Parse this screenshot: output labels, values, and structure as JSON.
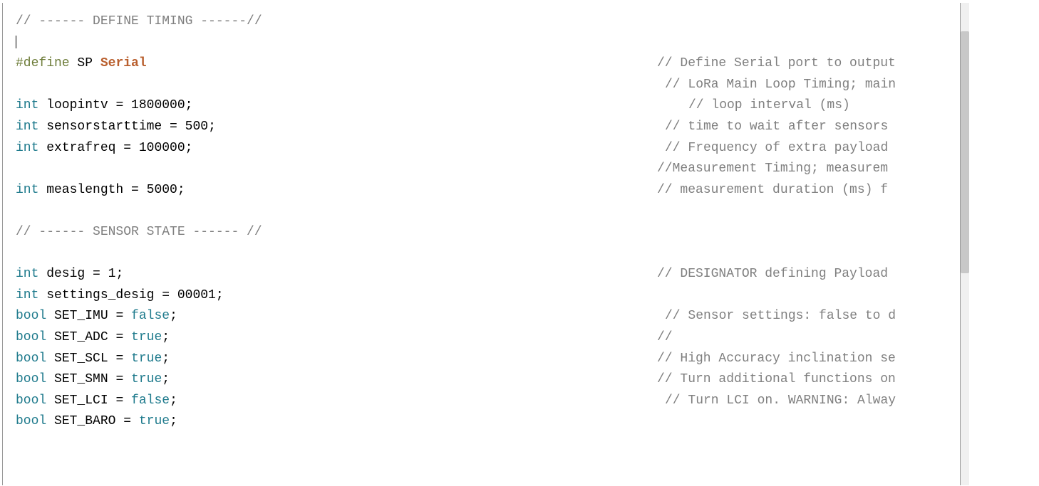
{
  "code": {
    "l1": {
      "text": "// ------ DEFINE TIMING ------//"
    },
    "l2": {
      "cursor": true
    },
    "l3": {
      "pre": "#define",
      "macro": " SP ",
      "ident": "Serial",
      "rcol": 918,
      "rcomment": "// Define Serial port to output"
    },
    "l4": {
      "rcol": 929,
      "rcomment": "// LoRa Main Loop Timing; main"
    },
    "l5": {
      "type": "int",
      "name": " loopintv ",
      "eq": "= ",
      "val": "1800000",
      "semi": ";",
      "rcol": 962,
      "rcomment": "// loop interval (ms)"
    },
    "l6": {
      "type": "int",
      "name": " sensorstarttime ",
      "eq": "= ",
      "val": "500",
      "semi": ";",
      "rcol": 929,
      "rcomment": "// time to wait after sensors "
    },
    "l7": {
      "type": "int",
      "name": " extrafreq ",
      "eq": "= ",
      "val": "100000",
      "semi": ";",
      "rcol": 929,
      "rcomment": "// Frequency of extra payload "
    },
    "l8": {
      "rcol": 918,
      "rcomment": "//Measurement Timing; measurem"
    },
    "l9": {
      "type": "int",
      "name": " measlength ",
      "eq": "= ",
      "val": "5000",
      "semi": ";",
      "rcol": 918,
      "rcomment": "// measurement duration (ms) f"
    },
    "l10": {},
    "l11": {
      "text": "// ------ SENSOR STATE ------ //"
    },
    "l12": {},
    "l13": {
      "type": "int",
      "name": " desig ",
      "eq": "= ",
      "val": "1",
      "semi": ";",
      "rcol": 918,
      "rcomment": "// DESIGNATOR defining Payload"
    },
    "l14": {
      "type": "int",
      "name": " settings_desig ",
      "eq": "= ",
      "val": "00001",
      "semi": ";"
    },
    "l15": {
      "type": "bool",
      "name": " SET_IMU ",
      "eq": "= ",
      "kw": "false",
      "semi": ";",
      "rcol": 929,
      "rcomment": "// Sensor settings: false to d"
    },
    "l16": {
      "type": "bool",
      "name": " SET_ADC ",
      "eq": "= ",
      "kw": "true",
      "semi": ";",
      "rcol": 918,
      "rcomment": "//"
    },
    "l17": {
      "type": "bool",
      "name": " SET_SCL ",
      "eq": "= ",
      "kw": "true",
      "semi": ";",
      "rcol": 918,
      "rcomment": "// High Accuracy inclination se"
    },
    "l18": {
      "type": "bool",
      "name": " SET_SMN ",
      "eq": "= ",
      "kw": "true",
      "semi": ";",
      "rcol": 918,
      "rcomment": "// Turn additional functions on"
    },
    "l19": {
      "type": "bool",
      "name": " SET_LCI ",
      "eq": "= ",
      "kw": "false",
      "semi": ";",
      "rcol": 929,
      "rcomment": "// Turn LCI on. WARNING: Alway"
    },
    "l20": {
      "type": "bool",
      "name": " SET_BARO ",
      "eq": "= ",
      "kw": "true",
      "semi": ";"
    }
  }
}
